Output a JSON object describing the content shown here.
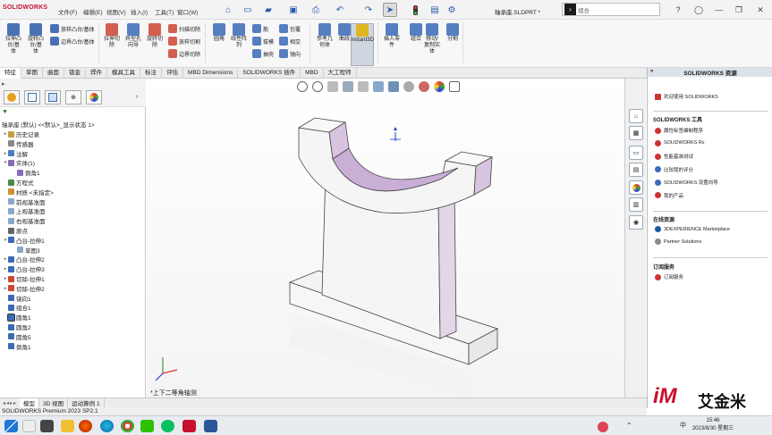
{
  "app": {
    "brand": "SOLIDWORKS",
    "document_title": "轴承座.SLDPRT *"
  },
  "menu": [
    "文件(F)",
    "编辑(E)",
    "视图(V)",
    "插入(I)",
    "工具(T)",
    "窗口(W)"
  ],
  "search": {
    "placeholder": "组合"
  },
  "ribbon": {
    "features": [
      {
        "label": "拉伸凸\n台/基\n体",
        "icon": "extrude-boss-icon"
      },
      {
        "label": "旋转凸\n台/基\n体",
        "icon": "revolve-boss-icon"
      },
      {
        "label": "扫描",
        "icon": "sweep-icon"
      },
      {
        "label": "放样凸台/基体",
        "icon": "loft-icon"
      },
      {
        "label": "边界凸台/基体",
        "icon": "boundary-boss-icon"
      },
      {
        "label": "拉伸切\n除",
        "icon": "extrude-cut-icon"
      },
      {
        "label": "异型孔\n向导",
        "icon": "hole-wizard-icon"
      },
      {
        "label": "旋转切\n除",
        "icon": "revolve-cut-icon"
      },
      {
        "label": "扫描切除",
        "icon": "swept-cut-icon"
      },
      {
        "label": "放样切割",
        "icon": "lofted-cut-icon"
      },
      {
        "label": "边界切除",
        "icon": "boundary-cut-icon"
      },
      {
        "label": "圆角",
        "icon": "fillet-icon"
      },
      {
        "label": "线性阵\n列",
        "icon": "linear-pattern-icon"
      },
      {
        "label": "筋",
        "icon": "rib-icon"
      },
      {
        "label": "拔模",
        "icon": "draft-icon"
      },
      {
        "label": "抽壳",
        "icon": "shell-icon"
      },
      {
        "label": "包覆",
        "icon": "wrap-icon"
      },
      {
        "label": "相交",
        "icon": "intersect-icon"
      },
      {
        "label": "镜向",
        "icon": "mirror-icon"
      },
      {
        "label": "参考几\n何体",
        "icon": "reference-geometry-icon"
      },
      {
        "label": "曲线",
        "icon": "curves-icon"
      },
      {
        "label": "Instant3D",
        "icon": "instant3d-icon"
      },
      {
        "label": "插入零\n件",
        "icon": "insert-part-icon"
      },
      {
        "label": "组合",
        "icon": "combine-icon"
      },
      {
        "label": "移动/\n复制实\n体",
        "icon": "move-copy-body-icon"
      },
      {
        "label": "分割",
        "icon": "split-icon"
      }
    ]
  },
  "tabs": [
    "特征",
    "草图",
    "曲面",
    "钣金",
    "焊件",
    "模具工具",
    "标注",
    "评估",
    "MBD Dimensions",
    "SOLIDWORKS 插件",
    "MBD",
    "大工程师"
  ],
  "tree": {
    "root": "轴承座 (默认) <<默认>_显示状态 1>",
    "items": [
      {
        "label": "历史记录",
        "indent": 0,
        "caret": "▸"
      },
      {
        "label": "传感器",
        "indent": 0,
        "caret": ""
      },
      {
        "label": "注解",
        "indent": 0,
        "caret": "▸"
      },
      {
        "label": "实体(1)",
        "indent": 0,
        "caret": "▾"
      },
      {
        "label": "倒角1",
        "indent": 1,
        "caret": ""
      },
      {
        "label": "方程式",
        "indent": 0,
        "caret": ""
      },
      {
        "label": "材质 <未指定>",
        "indent": 0,
        "caret": ""
      },
      {
        "label": "前视基准面",
        "indent": 0,
        "caret": ""
      },
      {
        "label": "上视基准面",
        "indent": 0,
        "caret": ""
      },
      {
        "label": "右视基准面",
        "indent": 0,
        "caret": ""
      },
      {
        "label": "原点",
        "indent": 0,
        "caret": ""
      },
      {
        "label": "凸台-拉伸1",
        "indent": 0,
        "caret": "▾"
      },
      {
        "label": "草图3",
        "indent": 1,
        "caret": ""
      },
      {
        "label": "凸台-拉伸2",
        "indent": 0,
        "caret": "▸"
      },
      {
        "label": "凸台-拉伸3",
        "indent": 0,
        "caret": "▸"
      },
      {
        "label": "切除-拉伸1",
        "indent": 0,
        "caret": "▸"
      },
      {
        "label": "切除-拉伸2",
        "indent": 0,
        "caret": "▸"
      },
      {
        "label": "镜向1",
        "indent": 0,
        "caret": ""
      },
      {
        "label": "组合1",
        "indent": 0,
        "caret": ""
      },
      {
        "label": "圆角1",
        "indent": 0,
        "caret": ""
      },
      {
        "label": "圆角2",
        "indent": 0,
        "caret": ""
      },
      {
        "label": "圆角5",
        "indent": 0,
        "caret": ""
      },
      {
        "label": "倒角1",
        "indent": 0,
        "caret": ""
      }
    ]
  },
  "viewport": {
    "view_label": "*上下二等角轴测"
  },
  "bottom_tabs": [
    "模型",
    "3D 视图",
    "运动算例 1"
  ],
  "status": "SOLIDWORKS Premium 2023 SP2.1",
  "taskpane": {
    "title": "SOLIDWORKS 资源",
    "welcome": "欢迎使用 SOLIDWORKS",
    "tools_title": "SOLIDWORKS 工具",
    "tools": [
      "属性标签编制程序",
      "SOLIDWORKS Rx",
      "性能基准测试",
      "比较我的评分",
      "SOLIDWORKS 设置向导",
      "我的产品"
    ],
    "online_title": "在线资源",
    "online": [
      "3DEXPERIENCE Marketplace",
      "Partner Solutions"
    ],
    "sub_title": "订阅服务",
    "sub": [
      "订阅服务"
    ]
  },
  "taskbar": {
    "time": "15:46",
    "date": "2023/8/30 星期三",
    "ime": "中"
  },
  "watermark": {
    "logo": "iM",
    "text": "艾金米"
  },
  "colors": {
    "accent": "#c8102e",
    "part_face": "#f2f2f2",
    "part_shade": "#d9c4e0",
    "ribbon_blue": "#2a5aa8"
  }
}
